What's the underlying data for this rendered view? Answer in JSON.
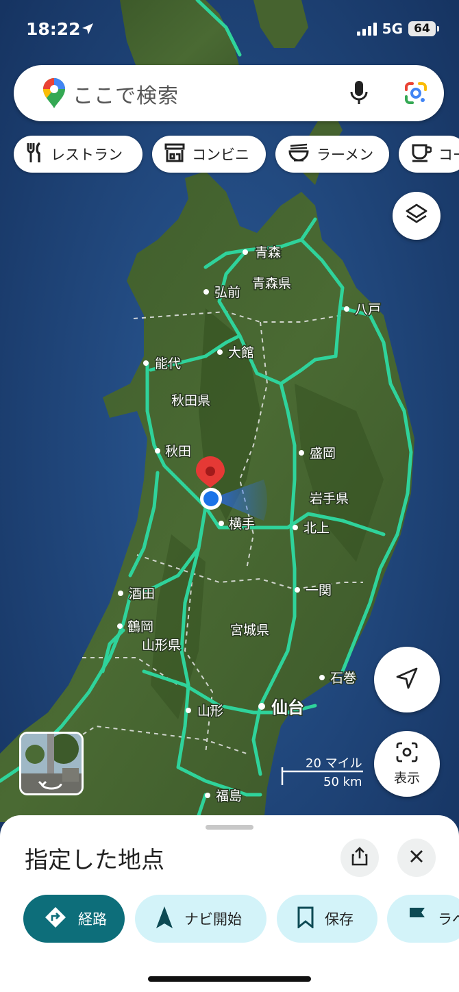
{
  "status_bar": {
    "time": "18:22",
    "network": "5G",
    "battery": "64"
  },
  "search": {
    "placeholder": "ここで検索"
  },
  "chips": [
    {
      "label": "レストラン",
      "icon": "fork-knife-icon"
    },
    {
      "label": "コンビニ",
      "icon": "store-icon"
    },
    {
      "label": "ラーメン",
      "icon": "ramen-bowl-icon"
    },
    {
      "label": "コー",
      "icon": "coffee-cup-icon"
    }
  ],
  "map": {
    "labels": [
      "青森",
      "青森県",
      "弘前",
      "八戸",
      "大館",
      "能代",
      "秋田県",
      "秋田",
      "盛岡",
      "岩手県",
      "横手",
      "北上",
      "酒田",
      "一関",
      "鶴岡",
      "山形県",
      "宮城県",
      "石巻",
      "山形",
      "仙台",
      "福島"
    ],
    "scale": {
      "miles": "20 マイル",
      "km": "50 km"
    },
    "display_label": "表示"
  },
  "sheet": {
    "title": "指定した地点",
    "actions": [
      {
        "label": "経路",
        "icon": "directions-icon"
      },
      {
        "label": "ナビ開始",
        "icon": "navigation-arrow-icon"
      },
      {
        "label": "保存",
        "icon": "bookmark-icon"
      },
      {
        "label": "ラベ",
        "icon": "flag-icon"
      }
    ]
  },
  "colors": {
    "accent": "#0d6e7a",
    "action_bg": "#d3f3f9",
    "road": "#2fd39b",
    "pin": "#e53935",
    "location": "#1a73e8"
  }
}
